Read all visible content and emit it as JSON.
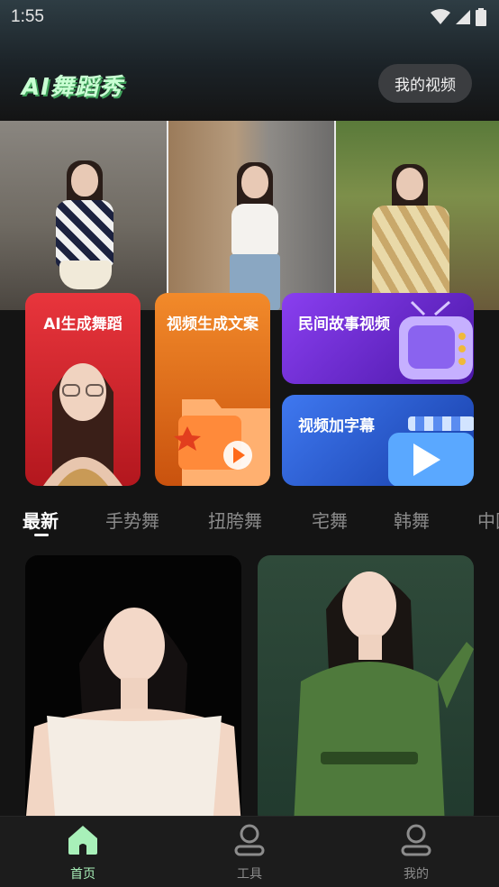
{
  "status_bar": {
    "time": "1:55"
  },
  "header": {
    "logo_text": "AI舞蹈秀",
    "my_videos_label": "我的视频"
  },
  "feature_cards": {
    "ai_dance": "AI生成舞蹈",
    "video_copywriting": "视频生成文案",
    "folk_story": "民间故事视频",
    "add_subtitles": "视频加字幕"
  },
  "tabs": [
    "最新",
    "手势舞",
    "扭胯舞",
    "宅舞",
    "韩舞",
    "中国"
  ],
  "bottom_nav": {
    "home": "首页",
    "tools": "工具",
    "mine": "我的"
  },
  "colors": {
    "accent": "#a8f0b9",
    "background": "#141414"
  }
}
